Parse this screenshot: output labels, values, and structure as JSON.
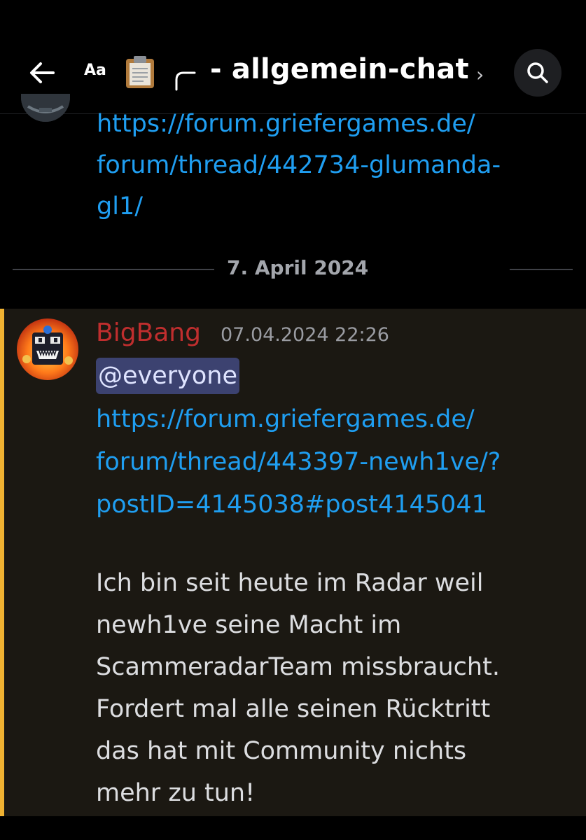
{
  "header": {
    "back_icon": "arrow-left-icon",
    "text_size_label": "Aa",
    "clipboard_icon": "clipboard-icon",
    "corner_icon": "thread-corner-icon",
    "channel_name": "- allgemein-chat",
    "chevron": "›",
    "search_icon": "search-icon"
  },
  "previous_message": {
    "link_lines": [
      "https://forum.griefergames.de/",
      "forum/thread/442734-glumanda-",
      "gl1/"
    ]
  },
  "date_divider": "7. April 2024",
  "message": {
    "author": "BigBang",
    "timestamp": "07.04.2024 22:26",
    "mention": "@everyone",
    "link_lines": [
      "https://forum.griefergames.de/",
      "forum/thread/443397-newh1ve/?",
      "postID=4145038#post4145041"
    ],
    "body_lines": [
      "Ich bin seit heute im Radar weil",
      "newh1ve seine Macht im",
      "ScammeradarTeam missbraucht.",
      "Fordert mal alle seinen Rücktritt",
      "das hat mit Community nichts",
      "mehr zu tun!"
    ]
  },
  "colors": {
    "background": "#000000",
    "mention_highlight_bg": "#1b1812",
    "mention_bar": "#f0b232",
    "link": "#1f9ef1",
    "author": "#c02e2e",
    "mention_pill": "#3c4270"
  }
}
